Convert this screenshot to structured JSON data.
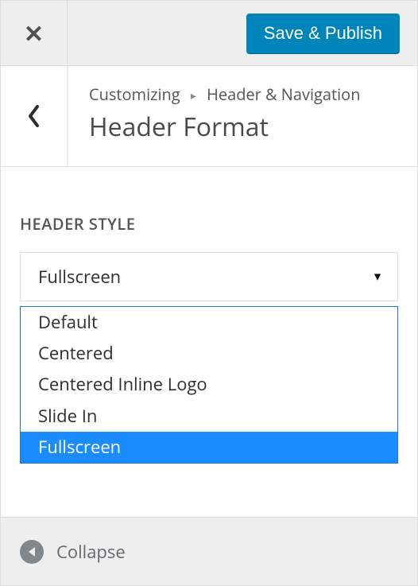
{
  "topbar": {
    "save_label": "Save & Publish"
  },
  "header": {
    "breadcrumb_root": "Customizing",
    "breadcrumb_section": "Header & Navigation",
    "title": "Header Format"
  },
  "section": {
    "label": "HEADER STYLE",
    "selected": "Fullscreen",
    "options": [
      "Default",
      "Centered",
      "Centered Inline Logo",
      "Slide In",
      "Fullscreen"
    ]
  },
  "footer": {
    "collapse_label": "Collapse"
  }
}
